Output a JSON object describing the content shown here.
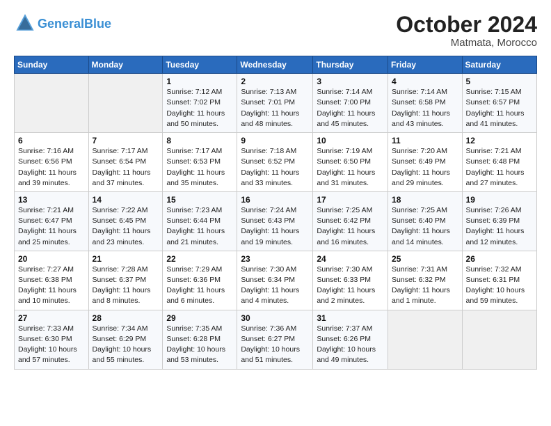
{
  "header": {
    "logo_line1": "General",
    "logo_line2": "Blue",
    "month": "October 2024",
    "location": "Matmata, Morocco"
  },
  "weekdays": [
    "Sunday",
    "Monday",
    "Tuesday",
    "Wednesday",
    "Thursday",
    "Friday",
    "Saturday"
  ],
  "weeks": [
    [
      {
        "day": "",
        "info": ""
      },
      {
        "day": "",
        "info": ""
      },
      {
        "day": "1",
        "info": "Sunrise: 7:12 AM\nSunset: 7:02 PM\nDaylight: 11 hours and 50 minutes."
      },
      {
        "day": "2",
        "info": "Sunrise: 7:13 AM\nSunset: 7:01 PM\nDaylight: 11 hours and 48 minutes."
      },
      {
        "day": "3",
        "info": "Sunrise: 7:14 AM\nSunset: 7:00 PM\nDaylight: 11 hours and 45 minutes."
      },
      {
        "day": "4",
        "info": "Sunrise: 7:14 AM\nSunset: 6:58 PM\nDaylight: 11 hours and 43 minutes."
      },
      {
        "day": "5",
        "info": "Sunrise: 7:15 AM\nSunset: 6:57 PM\nDaylight: 11 hours and 41 minutes."
      }
    ],
    [
      {
        "day": "6",
        "info": "Sunrise: 7:16 AM\nSunset: 6:56 PM\nDaylight: 11 hours and 39 minutes."
      },
      {
        "day": "7",
        "info": "Sunrise: 7:17 AM\nSunset: 6:54 PM\nDaylight: 11 hours and 37 minutes."
      },
      {
        "day": "8",
        "info": "Sunrise: 7:17 AM\nSunset: 6:53 PM\nDaylight: 11 hours and 35 minutes."
      },
      {
        "day": "9",
        "info": "Sunrise: 7:18 AM\nSunset: 6:52 PM\nDaylight: 11 hours and 33 minutes."
      },
      {
        "day": "10",
        "info": "Sunrise: 7:19 AM\nSunset: 6:50 PM\nDaylight: 11 hours and 31 minutes."
      },
      {
        "day": "11",
        "info": "Sunrise: 7:20 AM\nSunset: 6:49 PM\nDaylight: 11 hours and 29 minutes."
      },
      {
        "day": "12",
        "info": "Sunrise: 7:21 AM\nSunset: 6:48 PM\nDaylight: 11 hours and 27 minutes."
      }
    ],
    [
      {
        "day": "13",
        "info": "Sunrise: 7:21 AM\nSunset: 6:47 PM\nDaylight: 11 hours and 25 minutes."
      },
      {
        "day": "14",
        "info": "Sunrise: 7:22 AM\nSunset: 6:45 PM\nDaylight: 11 hours and 23 minutes."
      },
      {
        "day": "15",
        "info": "Sunrise: 7:23 AM\nSunset: 6:44 PM\nDaylight: 11 hours and 21 minutes."
      },
      {
        "day": "16",
        "info": "Sunrise: 7:24 AM\nSunset: 6:43 PM\nDaylight: 11 hours and 19 minutes."
      },
      {
        "day": "17",
        "info": "Sunrise: 7:25 AM\nSunset: 6:42 PM\nDaylight: 11 hours and 16 minutes."
      },
      {
        "day": "18",
        "info": "Sunrise: 7:25 AM\nSunset: 6:40 PM\nDaylight: 11 hours and 14 minutes."
      },
      {
        "day": "19",
        "info": "Sunrise: 7:26 AM\nSunset: 6:39 PM\nDaylight: 11 hours and 12 minutes."
      }
    ],
    [
      {
        "day": "20",
        "info": "Sunrise: 7:27 AM\nSunset: 6:38 PM\nDaylight: 11 hours and 10 minutes."
      },
      {
        "day": "21",
        "info": "Sunrise: 7:28 AM\nSunset: 6:37 PM\nDaylight: 11 hours and 8 minutes."
      },
      {
        "day": "22",
        "info": "Sunrise: 7:29 AM\nSunset: 6:36 PM\nDaylight: 11 hours and 6 minutes."
      },
      {
        "day": "23",
        "info": "Sunrise: 7:30 AM\nSunset: 6:34 PM\nDaylight: 11 hours and 4 minutes."
      },
      {
        "day": "24",
        "info": "Sunrise: 7:30 AM\nSunset: 6:33 PM\nDaylight: 11 hours and 2 minutes."
      },
      {
        "day": "25",
        "info": "Sunrise: 7:31 AM\nSunset: 6:32 PM\nDaylight: 11 hours and 1 minute."
      },
      {
        "day": "26",
        "info": "Sunrise: 7:32 AM\nSunset: 6:31 PM\nDaylight: 10 hours and 59 minutes."
      }
    ],
    [
      {
        "day": "27",
        "info": "Sunrise: 7:33 AM\nSunset: 6:30 PM\nDaylight: 10 hours and 57 minutes."
      },
      {
        "day": "28",
        "info": "Sunrise: 7:34 AM\nSunset: 6:29 PM\nDaylight: 10 hours and 55 minutes."
      },
      {
        "day": "29",
        "info": "Sunrise: 7:35 AM\nSunset: 6:28 PM\nDaylight: 10 hours and 53 minutes."
      },
      {
        "day": "30",
        "info": "Sunrise: 7:36 AM\nSunset: 6:27 PM\nDaylight: 10 hours and 51 minutes."
      },
      {
        "day": "31",
        "info": "Sunrise: 7:37 AM\nSunset: 6:26 PM\nDaylight: 10 hours and 49 minutes."
      },
      {
        "day": "",
        "info": ""
      },
      {
        "day": "",
        "info": ""
      }
    ]
  ]
}
